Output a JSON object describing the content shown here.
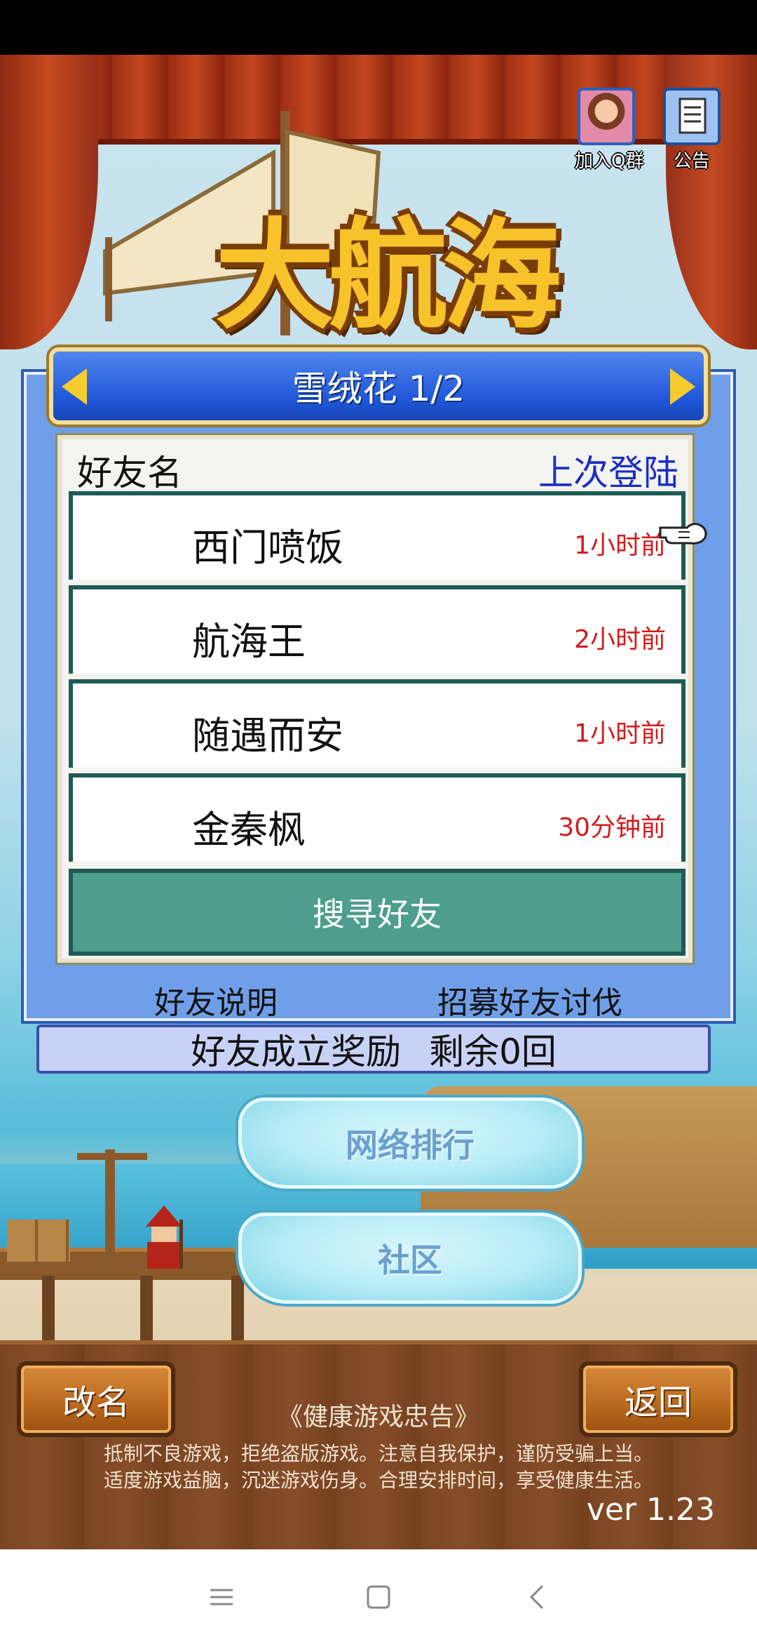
{
  "hud": {
    "qq_group_label": "加入Q群",
    "notice_label": "公告"
  },
  "logo": {
    "title": "大航海"
  },
  "panel": {
    "title": "雪绒花 1/2",
    "column_name": "好友名",
    "column_last_login": "上次登陆",
    "friends": [
      {
        "name": "西门喷饭",
        "last_login": "1小时前"
      },
      {
        "name": "航海王",
        "last_login": "2小时前"
      },
      {
        "name": "随遇而安",
        "last_login": "1小时前"
      },
      {
        "name": "金秦枫",
        "last_login": "30分钟前"
      }
    ],
    "search_label": "搜寻好友",
    "help_label": "好友说明",
    "recruit_label": "招募好友讨伐",
    "reward_label": "好友成立奖励",
    "reward_remaining": "剩余0回"
  },
  "menu": {
    "ranking_label": "网络排行",
    "community_label": "社区"
  },
  "footer": {
    "rename_label": "改名",
    "back_label": "返回",
    "health_title": "《健康游戏忠告》",
    "health_line1": "抵制不良游戏，拒绝盗版游戏。注意自我保护，谨防受骗上当。",
    "health_line2": "适度游戏益脑，沉迷游戏伤身。合理安排时间，享受健康生活。",
    "version": "ver 1.23"
  },
  "colors": {
    "panel_blue": "#6f9fe8",
    "header_blue": "#2057d9",
    "time_red": "#d21c1c",
    "login_blue": "#1b2fc2",
    "search_green": "#4e9e8e"
  },
  "icons": [
    "arrow-left-icon",
    "arrow-right-icon",
    "hand-cursor-icon",
    "qq-avatar-icon",
    "notice-icon",
    "menu-icon",
    "home-icon",
    "back-icon"
  ]
}
